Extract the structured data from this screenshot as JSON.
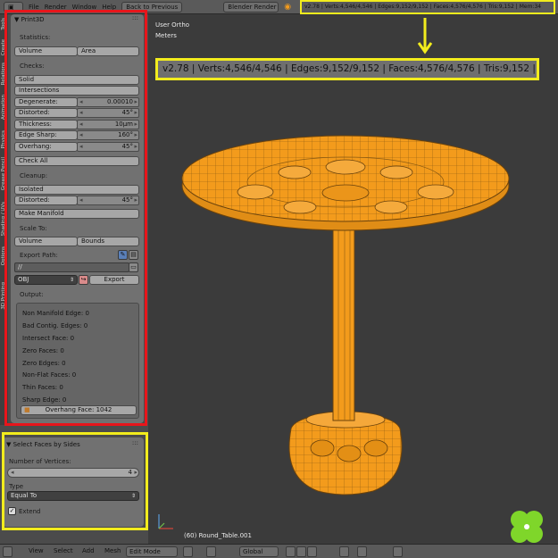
{
  "topbar": {
    "menus": [
      "File",
      "Render",
      "Window",
      "Help"
    ],
    "back_label": "Back to Previous",
    "engine": "Blender Render",
    "stats": "v2.78 | Verts:4,546/4,546 | Edges:9,152/9,152 | Faces:4,576/4,576 | Tris:9,152 | Mem:34"
  },
  "side_tabs": [
    "Tools",
    "Create",
    "Relations",
    "Animation",
    "Physics",
    "Grease Pencil",
    "Shading / UVs",
    "Options",
    "3D Printing"
  ],
  "print3d": {
    "title": "Print3D",
    "statistics": "Statistics:",
    "volume": "Volume",
    "area": "Area",
    "checks": "Checks:",
    "solid": "Solid",
    "intersections": "Intersections",
    "degenerate_label": "Degenerate:",
    "degenerate_value": "0.00010",
    "distorted_label": "Distorted:",
    "distorted_value": "45°",
    "thickness_label": "Thickness:",
    "thickness_value": "10μm",
    "edge_sharp_label": "Edge Sharp:",
    "edge_sharp_value": "160°",
    "overhang_label": "Overhang:",
    "overhang_value": "45°",
    "check_all": "Check All",
    "cleanup": "Cleanup:",
    "isolated": "Isolated",
    "distorted2_label": "Distorted:",
    "distorted2_value": "45°",
    "make_manifold": "Make Manifold",
    "scale_to": "Scale To:",
    "scale_volume": "Volume",
    "scale_bounds": "Bounds",
    "export_path": "Export Path:",
    "export_path_value": "//",
    "format": "OBJ",
    "export": "Export",
    "output": "Output:",
    "output_lines": [
      "Non Manifold Edge: 0",
      "Bad Contig. Edges: 0",
      "Intersect Face: 0",
      "Zero Faces: 0",
      "Zero Edges: 0",
      "Non-Flat Faces: 0",
      "Thin Faces: 0",
      "Sharp Edge: 0"
    ],
    "overhang_face": "Overhang Face: 1042"
  },
  "select_faces": {
    "title": "Select Faces by Sides",
    "num_vertices_label": "Number of Vertices:",
    "num_vertices_value": "4",
    "type_label": "Type",
    "type_value": "Equal To",
    "extend_label": "Extend",
    "extend_checked": true
  },
  "viewport": {
    "view_label": "User Ortho",
    "units_label": "Meters",
    "object_label": "(60) Round_Table.001"
  },
  "callout_stats": "v2.78 | Verts:4,546/4,546 | Edges:9,152/9,152 | Faces:4,576/4,576 | Tris:9,152 |",
  "bottombar": {
    "view": "View",
    "select": "Select",
    "add": "Add",
    "mesh": "Mesh",
    "mode": "Edit Mode",
    "orientation": "Global"
  },
  "colors": {
    "highlight_red": "#e8151b",
    "highlight_yellow": "#f2ec1d",
    "mesh_orange": "#f39b1c"
  }
}
